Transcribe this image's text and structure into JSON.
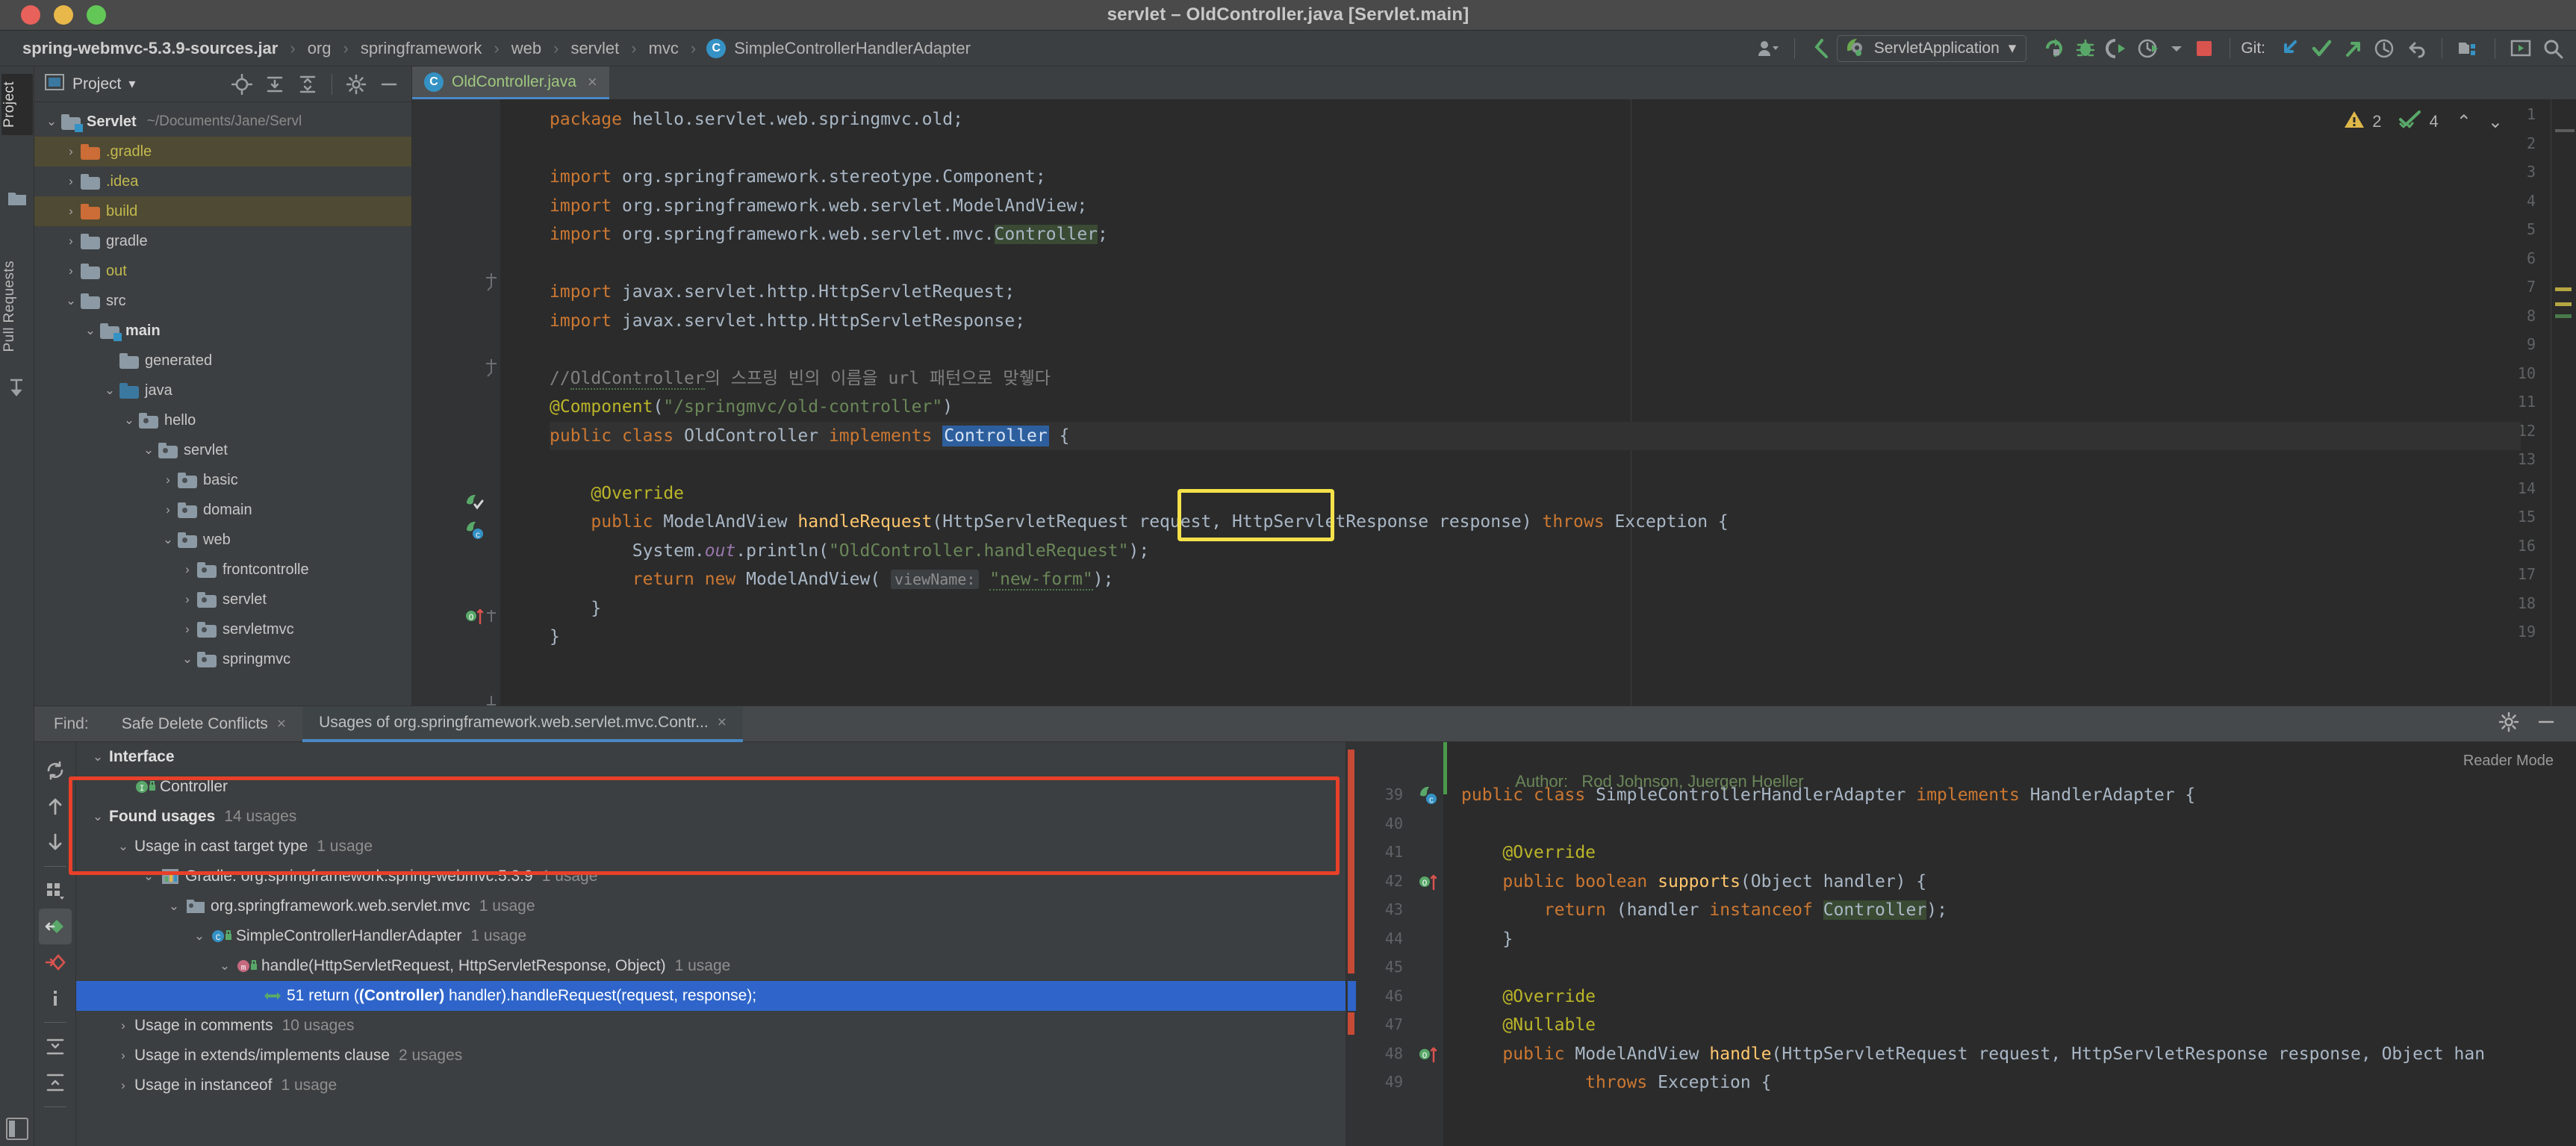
{
  "window": {
    "title": "servlet – OldController.java [Servlet.main]",
    "traffic_lights": [
      "close",
      "minimize",
      "zoom"
    ]
  },
  "breadcrumb": {
    "items": [
      {
        "label": "spring-webmvc-5.3.9-sources.jar",
        "type": "jar"
      },
      {
        "label": "org",
        "type": "package"
      },
      {
        "label": "springframework",
        "type": "package"
      },
      {
        "label": "web",
        "type": "package"
      },
      {
        "label": "servlet",
        "type": "package"
      },
      {
        "label": "mvc",
        "type": "package"
      },
      {
        "label": "SimpleControllerHandlerAdapter",
        "type": "class"
      }
    ],
    "separator": "›",
    "class_icon_letter": "C"
  },
  "toolbar": {
    "user_icon": "user-icon",
    "back_icon": "navigate-back-icon",
    "run_config": {
      "name": "ServletApplication",
      "icon": "spring-boot-icon",
      "chevron": "▾"
    },
    "run_icon": "run-icon",
    "debug_icon": "debug-icon",
    "run_with_coverage_icon": "coverage-icon",
    "profiler_icon": "profiler-icon",
    "stop_icon": "stop-icon",
    "git_label": "Git:",
    "git_update_icon": "update-project-icon",
    "git_commit_icon": "commit-icon",
    "git_push_icon": "push-icon",
    "history_icon": "history-icon",
    "rollback_icon": "rollback-icon",
    "search_everywhere_icon": "search-everywhere-icon",
    "project_structure_icon": "project-structure-icon",
    "settings_icon": "settings-icon"
  },
  "left_strip": {
    "tabs": [
      {
        "label": "Project",
        "active": true
      },
      {
        "label": "Pull Requests",
        "active": false
      }
    ]
  },
  "project_panel": {
    "header": {
      "title": "Project",
      "chevron": "▾",
      "icons": [
        "locate-icon",
        "expand-all-icon",
        "collapse-all-icon",
        "gear-icon",
        "hide-icon"
      ]
    },
    "tree": [
      {
        "depth": 0,
        "twisty": "⌄",
        "label": "Servlet",
        "path": "~/Documents/Jane/Servl",
        "icon": "module-folder",
        "bold": true,
        "highlight": false
      },
      {
        "depth": 1,
        "twisty": "›",
        "label": ".gradle",
        "icon": "excluded-folder",
        "yellow": true,
        "highlight": true
      },
      {
        "depth": 1,
        "twisty": "›",
        "label": ".idea",
        "icon": "folder",
        "yellow": true,
        "highlight": false
      },
      {
        "depth": 1,
        "twisty": "›",
        "label": "build",
        "icon": "excluded-folder",
        "yellow": true,
        "highlight": true
      },
      {
        "depth": 1,
        "twisty": "›",
        "label": "gradle",
        "icon": "folder",
        "highlight": false
      },
      {
        "depth": 1,
        "twisty": "›",
        "label": "out",
        "icon": "folder",
        "yellow": true,
        "highlight": false
      },
      {
        "depth": 1,
        "twisty": "⌄",
        "label": "src",
        "icon": "folder",
        "highlight": false
      },
      {
        "depth": 2,
        "twisty": "⌄",
        "label": "main",
        "icon": "module-folder",
        "bold": true,
        "highlight": false
      },
      {
        "depth": 3,
        "twisty": "",
        "label": "generated",
        "icon": "folder",
        "highlight": false
      },
      {
        "depth": 3,
        "twisty": "⌄",
        "label": "java",
        "icon": "source-folder",
        "highlight": false
      },
      {
        "depth": 4,
        "twisty": "⌄",
        "label": "hello",
        "icon": "package",
        "highlight": false
      },
      {
        "depth": 5,
        "twisty": "⌄",
        "label": "servlet",
        "icon": "package",
        "highlight": false
      },
      {
        "depth": 6,
        "twisty": "›",
        "label": "basic",
        "icon": "package",
        "highlight": false
      },
      {
        "depth": 6,
        "twisty": "›",
        "label": "domain",
        "icon": "package",
        "highlight": false
      },
      {
        "depth": 6,
        "twisty": "⌄",
        "label": "web",
        "icon": "package",
        "highlight": false
      },
      {
        "depth": 7,
        "twisty": "›",
        "label": "frontcontrolle",
        "icon": "package",
        "highlight": false
      },
      {
        "depth": 7,
        "twisty": "›",
        "label": "servlet",
        "icon": "package",
        "highlight": false
      },
      {
        "depth": 7,
        "twisty": "›",
        "label": "servletmvc",
        "icon": "package",
        "highlight": false
      },
      {
        "depth": 7,
        "twisty": "⌄",
        "label": "springmvc",
        "icon": "package",
        "highlight": false
      }
    ]
  },
  "editor": {
    "tab": {
      "name": "OldController.java",
      "icon_letter": "C",
      "close": "×"
    },
    "inspections": {
      "warning_icon": "warning-triangle-icon",
      "warning_count": "2",
      "ok_icon": "inspection-ok-icon",
      "ok_count": "4",
      "prev_icon": "⌃",
      "next_icon": "⌄"
    },
    "lines": [
      {
        "n": "1",
        "text": "package hello.servlet.web.springmvc.old;"
      },
      {
        "n": "2",
        "text": ""
      },
      {
        "n": "3",
        "text": "import org.springframework.stereotype.Component;"
      },
      {
        "n": "4",
        "text": "import org.springframework.web.servlet.ModelAndView;"
      },
      {
        "n": "5",
        "text": "import org.springframework.web.servlet.mvc.Controller;"
      },
      {
        "n": "6",
        "text": ""
      },
      {
        "n": "7",
        "text": "import javax.servlet.http.HttpServletRequest;"
      },
      {
        "n": "8",
        "text": "import javax.servlet.http.HttpServletResponse;"
      },
      {
        "n": "9",
        "text": ""
      },
      {
        "n": "10",
        "text": "//OldController의 스프링 빈의 이름을 url 패턴으로 맞췧다"
      },
      {
        "n": "11",
        "text": "@Component(\"/springmvc/old-controller\")"
      },
      {
        "n": "12",
        "text": "public class OldController implements Controller {"
      },
      {
        "n": "13",
        "text": ""
      },
      {
        "n": "14",
        "text": "    @Override"
      },
      {
        "n": "15",
        "text": "    public ModelAndView handleRequest(HttpServletRequest request, HttpServletResponse response) throws Exception {"
      },
      {
        "n": "16",
        "text": "        System.out.println(\"OldController.handleRequest\");"
      },
      {
        "n": "17",
        "text": "        return new ModelAndView( viewName: \"new-form\");"
      },
      {
        "n": "18",
        "text": "    }"
      },
      {
        "n": "19",
        "text": "}"
      }
    ],
    "annotation": {
      "type": "yellow-highlight-box",
      "target": "Controller"
    }
  },
  "find": {
    "label": "Find:",
    "tabs": [
      {
        "label": "Safe Delete Conflicts",
        "active": false,
        "close": "×"
      },
      {
        "label": "Usages of org.springframework.web.servlet.mvc.Contr...",
        "active": true,
        "close": "×"
      }
    ],
    "right_icons": [
      "settings-icon",
      "hide-icon"
    ],
    "toolbar_icons": [
      "rerun-icon",
      "previous-occurrence-icon",
      "next-occurrence-icon",
      "group-by-icon",
      "expand-usages-icon",
      "exclude-usage-icon",
      "info-icon",
      "expand-all-icon",
      "collapse-all-icon"
    ],
    "tree": [
      {
        "depth": 0,
        "twisty": "⌄",
        "label": "Interface",
        "count": "",
        "bold": true,
        "icon": "",
        "selected": false
      },
      {
        "depth": 1,
        "twisty": "",
        "label": "Controller",
        "count": "",
        "icon": "interface-icon",
        "selected": false
      },
      {
        "depth": 0,
        "twisty": "⌄",
        "label": "Found usages",
        "count": "14 usages",
        "bold": true,
        "icon": "",
        "selected": false
      },
      {
        "depth": 1,
        "twisty": "⌄",
        "label": "Usage in cast target type",
        "count": "1 usage",
        "icon": "",
        "selected": false
      },
      {
        "depth": 2,
        "twisty": "⌄",
        "label": "Gradle: org.springframework:spring-webmvc:5.3.9",
        "count": "1 usage",
        "icon": "library-icon",
        "selected": false
      },
      {
        "depth": 3,
        "twisty": "⌄",
        "label": "org.springframework.web.servlet.mvc",
        "count": "1 usage",
        "icon": "package-icon",
        "selected": false
      },
      {
        "depth": 4,
        "twisty": "⌄",
        "label": "SimpleControllerHandlerAdapter",
        "count": "1 usage",
        "icon": "class-icon",
        "selected": false
      },
      {
        "depth": 5,
        "twisty": "⌄",
        "label": "handle(HttpServletRequest, HttpServletResponse, Object)",
        "count": "1 usage",
        "icon": "method-icon",
        "selected": false
      },
      {
        "depth": 6,
        "twisty": "",
        "label": "51 return ((Controller) handler).handleRequest(request, response);",
        "count": "",
        "icon": "occurrence-icon",
        "selected": true
      },
      {
        "depth": 1,
        "twisty": "›",
        "label": "Usage in comments",
        "count": "10 usages",
        "icon": "",
        "selected": false
      },
      {
        "depth": 1,
        "twisty": "›",
        "label": "Usage in extends/implements clause",
        "count": "2 usages",
        "icon": "",
        "selected": false
      },
      {
        "depth": 1,
        "twisty": "›",
        "label": "Usage in instanceof",
        "count": "1 usage",
        "icon": "",
        "selected": false
      }
    ],
    "annotation": {
      "type": "red-highlight-box",
      "target": "found-usages-subtree"
    }
  },
  "preview": {
    "reader_mode_label": "Reader Mode",
    "doc_author_label": "Author:",
    "doc_author_value": "Rod Johnson, Juergen Hoeller",
    "lines": [
      {
        "n": "39",
        "text": "public class SimpleControllerHandlerAdapter implements HandlerAdapter {"
      },
      {
        "n": "40",
        "text": ""
      },
      {
        "n": "41",
        "text": "    @Override"
      },
      {
        "n": "42",
        "text": "    public boolean supports(Object handler) {"
      },
      {
        "n": "43",
        "text": "        return (handler instanceof Controller);"
      },
      {
        "n": "44",
        "text": "    }"
      },
      {
        "n": "45",
        "text": ""
      },
      {
        "n": "46",
        "text": "    @Override"
      },
      {
        "n": "47",
        "text": "    @Nullable"
      },
      {
        "n": "48",
        "text": "    public ModelAndView handle(HttpServletRequest request, HttpServletResponse response, Object han"
      },
      {
        "n": "49",
        "text": "            throws Exception {"
      }
    ]
  },
  "colors": {
    "accent_blue": "#4a88c7",
    "selection_blue": "#2f65ca",
    "keyword_orange": "#cc7832",
    "string_green": "#6a8759",
    "annotation_yellow": "#bbb529",
    "identifier": "#a9b7c6",
    "method_yellow": "#ffc66d",
    "highlight_box_yellow": "#f5e24a",
    "highlight_box_red": "#e8402a",
    "editor_bg": "#2b2b2b",
    "panel_bg": "#3c3f41"
  }
}
